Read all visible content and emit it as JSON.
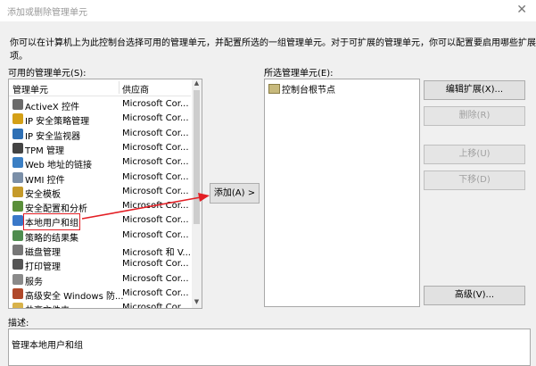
{
  "window": {
    "title": "添加或删除管理单元",
    "close": "✕"
  },
  "intro": "你可以在计算机上为此控制台选择可用的管理单元，并配置所选的一组管理单元。对于可扩展的管理单元，你可以配置要启用哪些扩展项。",
  "available": {
    "label": "可用的管理单元(S):",
    "col_name": "管理单元",
    "col_vendor": "供应商",
    "rows": [
      {
        "name": "ActiveX 控件",
        "vendor": "Microsoft Cor...",
        "icon": "activex-icon"
      },
      {
        "name": "IP 安全策略管理",
        "vendor": "Microsoft Cor...",
        "icon": "ip-policy-icon"
      },
      {
        "name": "IP 安全监视器",
        "vendor": "Microsoft Cor...",
        "icon": "ip-monitor-icon"
      },
      {
        "name": "TPM 管理",
        "vendor": "Microsoft Cor...",
        "icon": "tpm-icon"
      },
      {
        "name": "Web 地址的链接",
        "vendor": "Microsoft Cor...",
        "icon": "web-link-icon"
      },
      {
        "name": "WMI 控件",
        "vendor": "Microsoft Cor...",
        "icon": "wmi-icon"
      },
      {
        "name": "安全模板",
        "vendor": "Microsoft Cor...",
        "icon": "security-template-icon"
      },
      {
        "name": "安全配置和分析",
        "vendor": "Microsoft Cor...",
        "icon": "security-config-icon"
      },
      {
        "name": "本地用户和组",
        "vendor": "Microsoft Cor...",
        "icon": "local-users-icon"
      },
      {
        "name": "策略的结果集",
        "vendor": "Microsoft Cor...",
        "icon": "rsop-icon"
      },
      {
        "name": "磁盘管理",
        "vendor": "Microsoft 和 V...",
        "icon": "disk-icon"
      },
      {
        "name": "打印管理",
        "vendor": "Microsoft Cor...",
        "icon": "print-icon"
      },
      {
        "name": "服务",
        "vendor": "Microsoft Cor...",
        "icon": "services-icon"
      },
      {
        "name": "高级安全 Windows 防...",
        "vendor": "Microsoft Cor...",
        "icon": "firewall-icon"
      },
      {
        "name": "共享文件夹",
        "vendor": "Microsoft Cor...",
        "icon": "shared-folder-icon"
      }
    ]
  },
  "add_button": "添加(A) >",
  "selected": {
    "label": "所选管理单元(E):",
    "node": "控制台根节点"
  },
  "buttons": {
    "edit_ext": "编辑扩展(X)...",
    "remove": "删除(R)",
    "move_up": "上移(U)",
    "move_down": "下移(D)",
    "advanced": "高级(V)..."
  },
  "description": {
    "label": "描述:",
    "text": "管理本地用户和组"
  },
  "colors": {
    "highlight": "#e31e24"
  }
}
